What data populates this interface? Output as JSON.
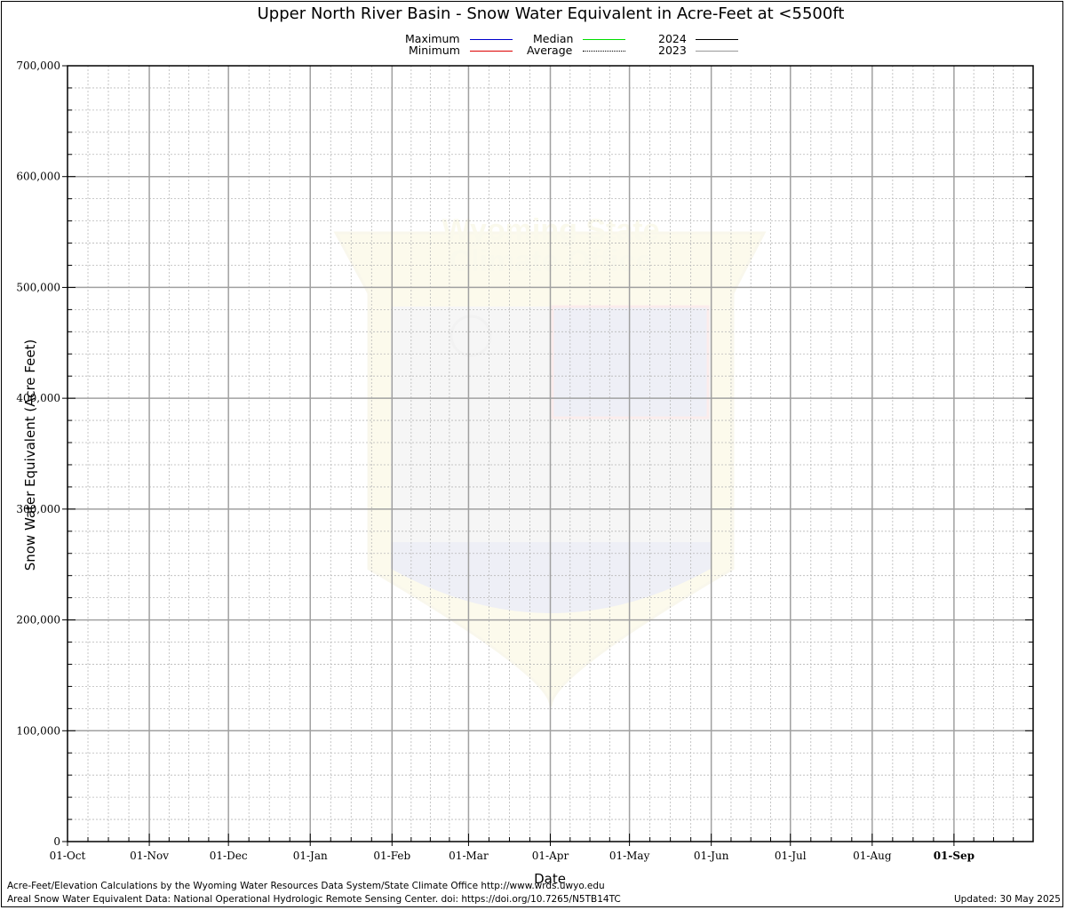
{
  "chart_data": {
    "type": "line",
    "title": "Upper North River Basin - Snow Water Equivalent in Acre-Feet at <5500ft",
    "xlabel": "Date",
    "ylabel": "Snow Water Equivalent (Acre Feet)",
    "x_categories": [
      "01-Oct",
      "01-Nov",
      "01-Dec",
      "01-Jan",
      "01-Feb",
      "01-Mar",
      "01-Apr",
      "01-May",
      "01-Jun",
      "01-Jul",
      "01-Aug",
      "01-Sep"
    ],
    "y_ticks": [
      "0",
      "100,000",
      "200,000",
      "300,000",
      "400,000",
      "500,000",
      "600,000",
      "700,000"
    ],
    "ylim": [
      0,
      700000
    ],
    "grid": true,
    "legend_position": "top-center",
    "series": [
      {
        "name": "Maximum",
        "color": "#0000cc",
        "style": "solid",
        "values": []
      },
      {
        "name": "Minimum",
        "color": "#dd0000",
        "style": "solid",
        "values": []
      },
      {
        "name": "Median",
        "color": "#00dd00",
        "style": "solid",
        "values": []
      },
      {
        "name": "Average",
        "color": "#000000",
        "style": "dotted",
        "values": []
      },
      {
        "name": "2024",
        "color": "#000000",
        "style": "solid",
        "values": []
      },
      {
        "name": "2023",
        "color": "#999999",
        "style": "solid",
        "values": []
      }
    ]
  },
  "watermark": {
    "line1": "Wyoming State",
    "line2": "Climate Office"
  },
  "footer": {
    "line1": "Acre-Feet/Elevation Calculations by the Wyoming Water Resources Data System/State Climate Office http://www.wrds.uwyo.edu",
    "line2": "Areal Snow Water Equivalent Data: National Operational Hydrologic Remote Sensing Center. doi: https://doi.org/10.7265/N5TB14TC",
    "updated": "Updated: 30 May 2025"
  }
}
